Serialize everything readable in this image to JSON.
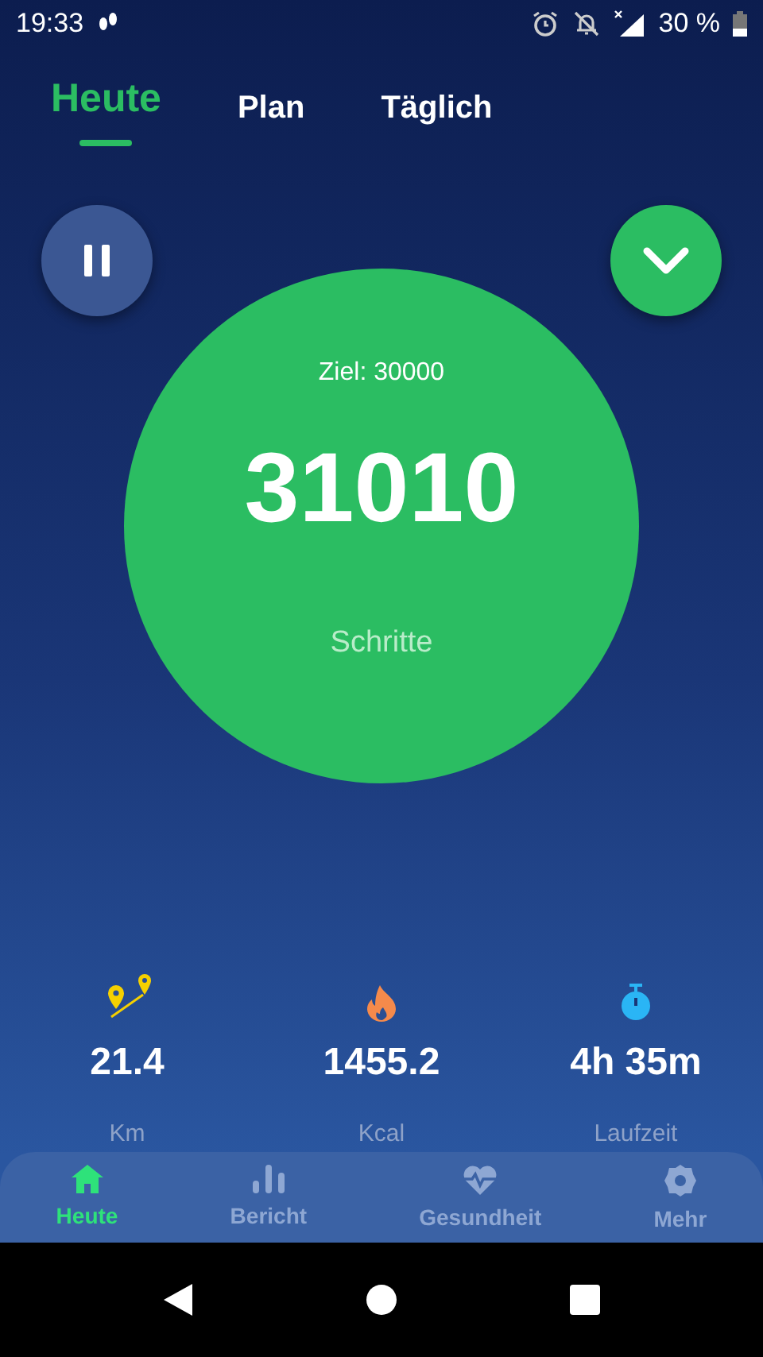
{
  "status_bar": {
    "time": "19:33",
    "battery": "30 %"
  },
  "tabs": [
    {
      "label": "Heute",
      "selected": true
    },
    {
      "label": "Plan",
      "selected": false
    },
    {
      "label": "Täglich",
      "selected": false
    }
  ],
  "paused": false,
  "goal": "Ziel: 30000",
  "steps": "31010",
  "steps_label": "Schritte",
  "stats": [
    {
      "kind": "distance",
      "value": "21.4",
      "unit": "Km"
    },
    {
      "kind": "calories",
      "value": "1455.2",
      "unit": "Kcal"
    },
    {
      "kind": "time",
      "value": "4h 35m",
      "unit": "Laufzeit"
    }
  ],
  "bottom_nav": [
    {
      "kind": "home",
      "label": "Heute",
      "selected": true
    },
    {
      "kind": "report",
      "label": "Bericht",
      "selected": false
    },
    {
      "kind": "health",
      "label": "Gesundheit",
      "selected": false
    },
    {
      "kind": "settings",
      "label": "Mehr",
      "selected": false
    }
  ]
}
